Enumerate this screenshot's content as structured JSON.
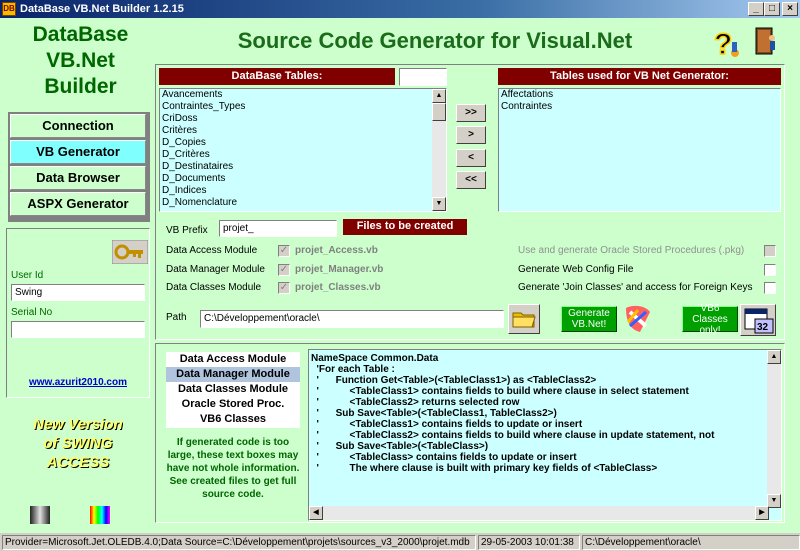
{
  "window": {
    "title": "DataBase VB.Net Builder 1.2.15",
    "minimize": "_",
    "maximize": "□",
    "close": "×"
  },
  "logo": {
    "line1": "DataBase",
    "line2": "VB.Net",
    "line3": "Builder"
  },
  "heading": "Source Code Generator for Visual.Net",
  "nav": {
    "connection": "Connection",
    "vb_generator": "VB Generator",
    "data_browser": "Data Browser",
    "aspx_generator": "ASPX Generator"
  },
  "user": {
    "userid_label": "User Id",
    "userid_value": "Swing",
    "serial_label": "Serial No",
    "serial_value": ""
  },
  "website": "www.azurit2010.com",
  "promo": {
    "line1": "New Version",
    "line2": "of SWING",
    "line3": "ACCESS"
  },
  "db_tables": {
    "header": "DataBase Tables:",
    "filter": "",
    "items": [
      "Avancements",
      "Contraintes_Types",
      "CriDoss",
      "Critères",
      "D_Copies",
      "D_Critères",
      "D_Destinataires",
      "D_Documents",
      "D_Indices",
      "D_Nomenclature"
    ]
  },
  "move_buttons": {
    "add_all": ">>",
    "add": ">",
    "remove": "<",
    "remove_all": "<<"
  },
  "vb_tables": {
    "header": "Tables used for VB Net Generator:",
    "items": [
      "Affectations",
      "Contraintes"
    ]
  },
  "options": {
    "vb_prefix_label": "VB Prefix",
    "vb_prefix_value": "projet_",
    "files_badge": "Files to be created",
    "data_access_label": "Data Access Module",
    "data_access_file": "projet_Access.vb",
    "data_manager_label": "Data Manager Module",
    "data_manager_file": "projet_Manager.vb",
    "data_classes_label": "Data Classes Module",
    "data_classes_file": "projet_Classes.vb",
    "oracle_sp_label": "Use and generate Oracle Stored Procedures (.pkg)",
    "web_config_label": "Generate Web Config File",
    "join_classes_label": "Generate 'Join Classes' and access for Foreign Keys",
    "check_mark": "✓",
    "path_label": "Path",
    "path_value": "C:\\Développement\\oracle\\",
    "generate_label": "Generate VB.Net!",
    "vb6_label": "VB6 Classes only!",
    "vb6_icon_text": "32"
  },
  "modules": [
    "Data Access Module",
    "Data Manager Module",
    "Data Classes Module",
    "Oracle Stored Proc.",
    "VB6 Classes"
  ],
  "modules_selected": "Data Manager Module",
  "note": "If generated code is too large, these text boxes may have not whole information. See created files to get full source code.",
  "code_lines": [
    "NameSpace Common.Data",
    "  'For each Table :",
    "  '      Function Get<Table>(<TableClass1>) as <TableClass2>",
    "  '           <TableClass1> contains fields to build where clause in select statement",
    "  '           <TableClass2> returns selected row",
    "  '      Sub Save<Table>(<TableClass1, TableClass2>)",
    "  '           <TableClass1> contains fields to update or insert",
    "  '           <TableClass2> contains fields to build where clause in update statement, not",
    "  '      Sub Save<Table>(<TableClass>)",
    "  '           <TableClass> contains fields to update or insert",
    "  '           The where clause is built with primary key fields of <TableClass>"
  ],
  "status": {
    "connection": "Provider=Microsoft.Jet.OLEDB.4.0;Data Source=C:\\Développement\\projets\\sources_v3_2000\\projet.mdb",
    "datetime": "29-05-2003 10:01:38",
    "path": "C:\\Développement\\oracle\\"
  },
  "colors": {
    "accent_red": "#800000",
    "mint": "#ccffcc",
    "cyan": "#ccffff",
    "title_green": "#1a6b1a",
    "green_button": "#00a000"
  }
}
